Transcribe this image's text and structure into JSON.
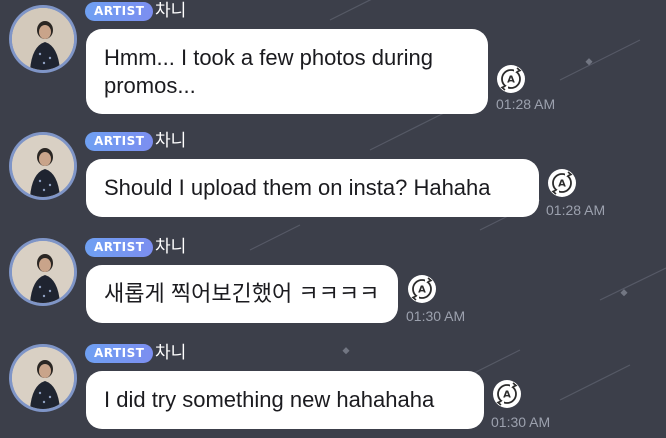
{
  "messages": [
    {
      "badge": "ARTIST",
      "name": "차니",
      "text": "Hmm... I took a few photos during promos...",
      "time": "01:28 AM"
    },
    {
      "badge": "ARTIST",
      "name": "차니",
      "text": "Should I upload them on insta? Hahaha",
      "time": "01:28 AM"
    },
    {
      "badge": "ARTIST",
      "name": "차니",
      "text": "새롭게 찍어보긴했어 ㅋㅋㅋㅋ",
      "time": "01:30 AM"
    },
    {
      "badge": "ARTIST",
      "name": "차니",
      "text": "I did try something new hahahaha",
      "time": "01:30 AM"
    }
  ],
  "icons": {
    "avatar": "artist-profile-photo",
    "translate": "translate-icon"
  },
  "colors": {
    "background": "#3c3f4a",
    "badge": "#7c8ef0",
    "bubble": "#ffffff",
    "timestamp": "#9ca1ae"
  }
}
